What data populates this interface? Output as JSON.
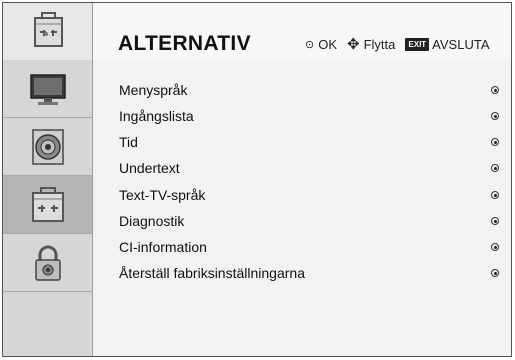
{
  "header": {
    "title": "ALTERNATIV",
    "icon": "toolbox-icon",
    "hints": {
      "ok_label": "OK",
      "move_label": "Flytta",
      "exit_badge": "EXIT",
      "exit_label": "AVSLUTA"
    }
  },
  "sidebar": {
    "items": [
      {
        "icon": "tv-icon",
        "active": false
      },
      {
        "icon": "speaker-icon",
        "active": false
      },
      {
        "icon": "toolbox-icon",
        "active": true
      },
      {
        "icon": "lock-icon",
        "active": false
      }
    ]
  },
  "menu": {
    "items": [
      {
        "label": "Menyspråk"
      },
      {
        "label": "Ingångslista"
      },
      {
        "label": "Tid"
      },
      {
        "label": "Undertext"
      },
      {
        "label": "Text-TV-språk"
      },
      {
        "label": "Diagnostik"
      },
      {
        "label": "CI-information"
      },
      {
        "label": "Återställ fabriksinställningarna"
      }
    ]
  }
}
